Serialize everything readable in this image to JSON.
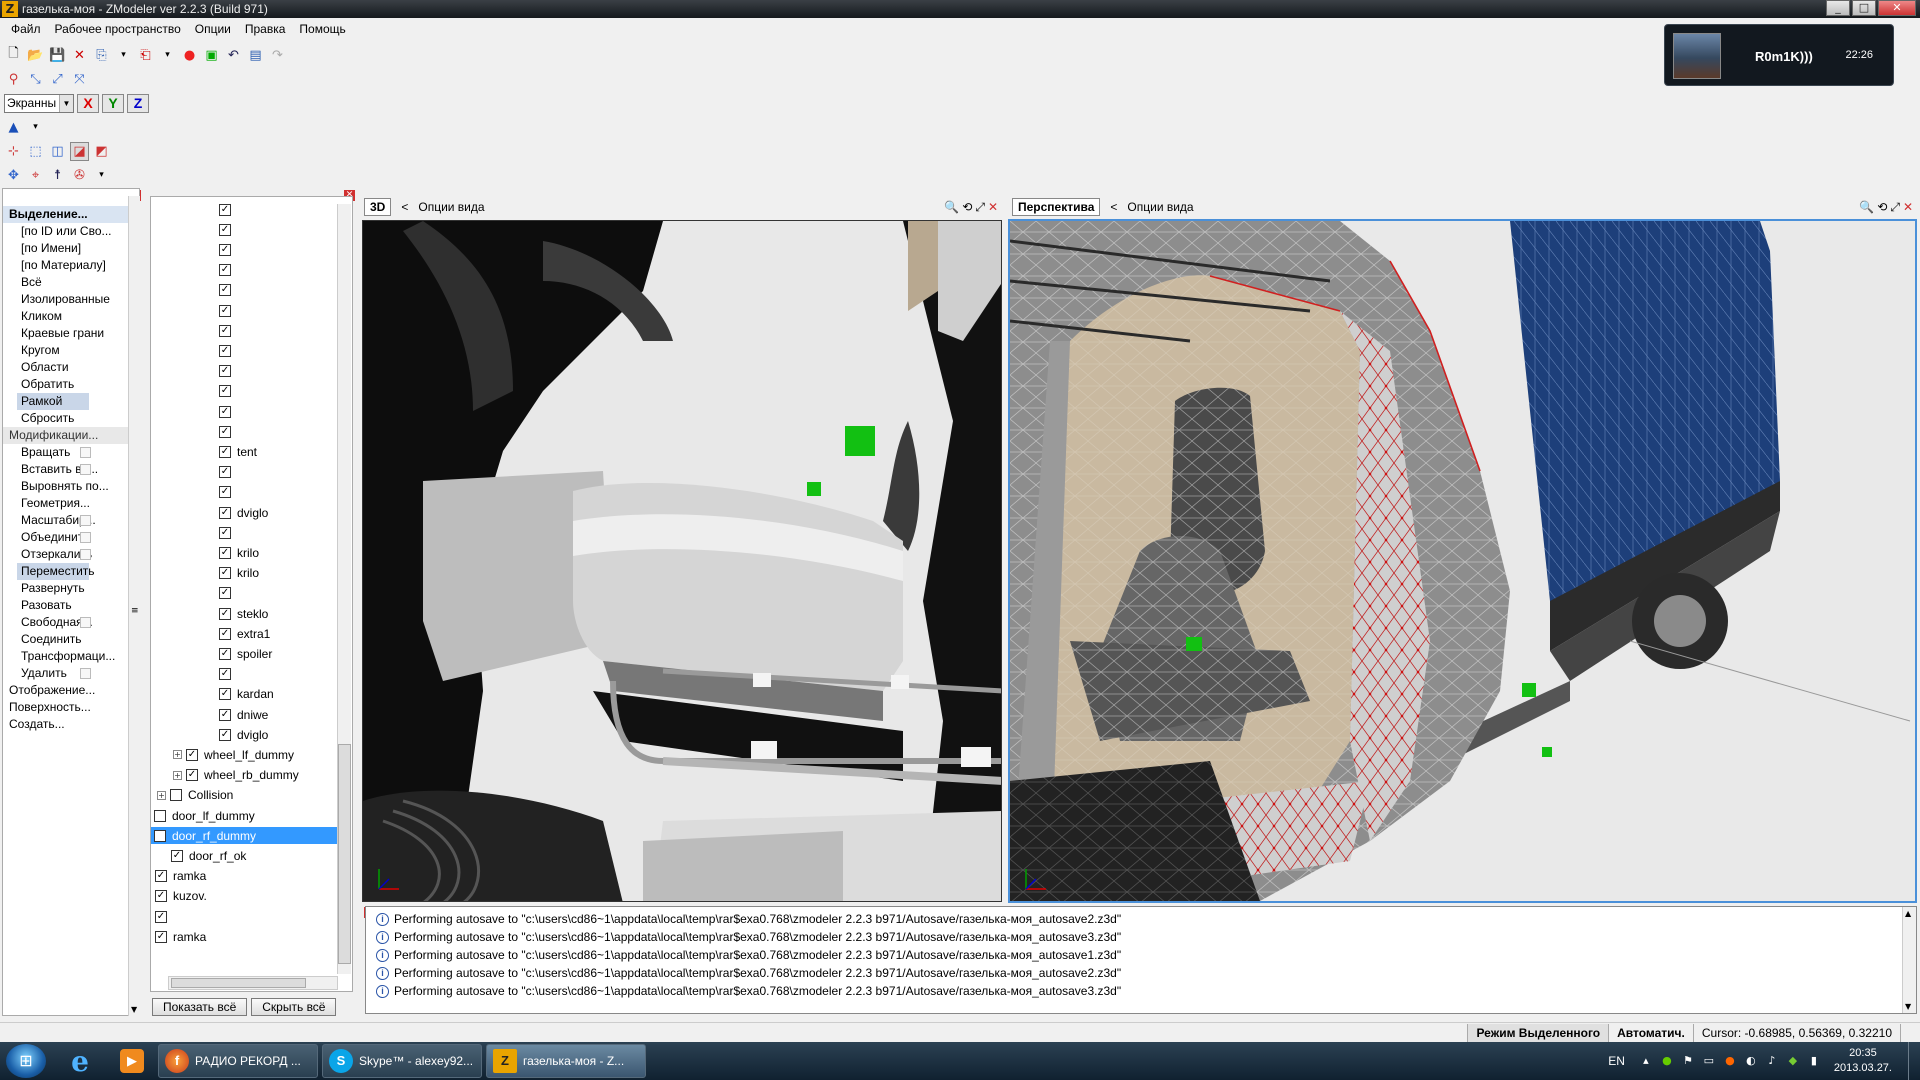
{
  "window": {
    "title": "газелька-моя - ZModeler ver 2.2.3 (Build 971)",
    "icon_letter": "Z"
  },
  "menu": [
    "Файл",
    "Рабочее пространство",
    "Опции",
    "Правка",
    "Помощь"
  ],
  "coord_combo": "Экранны",
  "axes": [
    "X",
    "Y",
    "Z"
  ],
  "skype_popup": {
    "name": "R0m1K)))",
    "time": "22:26"
  },
  "left_panel": {
    "selection_header": "Выделение...",
    "selection_items": [
      "[по ID или Сво...",
      "[по Имени]",
      "[по Материалу]",
      "Всё",
      "Изолированные",
      "Кликом",
      "Краевые грани",
      "Кругом",
      "Области",
      "Обратить",
      "Рамкой",
      "Сбросить"
    ],
    "modification_header": "Модификации...",
    "modification_items": [
      "Вращать",
      "Вставить ве...",
      "Выровнять по...",
      "Геометрия...",
      "Масштабир...",
      "Объединить",
      "Отзеркалить",
      "Переместить",
      "Развернуть",
      "Разовать",
      "Свободная...",
      "Соединить",
      "Трансформаци...",
      "Удалить"
    ],
    "bottom_items": [
      "Отображение...",
      "Поверхность...",
      "Создать..."
    ]
  },
  "tree": {
    "nested_labels": [
      "",
      "",
      "",
      "",
      "",
      "",
      "",
      "",
      "",
      "",
      "",
      "",
      "tent",
      "",
      "",
      "dviglo",
      "",
      "krilo",
      "krilo",
      "",
      "steklo",
      "extra1",
      "spoiler",
      "",
      "kardan",
      "dniwe",
      "dviglo"
    ],
    "groups": [
      "wheel_lf_dummy",
      "wheel_rb_dummy"
    ],
    "collision": "Collision",
    "root_items": [
      {
        "label": "door_lf_dummy",
        "checked": false
      },
      {
        "label": "door_rf_dummy",
        "checked": false,
        "selected": true
      },
      {
        "label": "door_rf_ok",
        "checked": true,
        "child": true
      },
      {
        "label": "ramka",
        "checked": true
      },
      {
        "label": "kuzov.",
        "checked": true
      },
      {
        "label": "",
        "checked": true
      },
      {
        "label": "ramka",
        "checked": true
      }
    ],
    "show_all": "Показать всё",
    "hide_all": "Скрыть всё"
  },
  "viewports": {
    "left": {
      "label": "3D",
      "options": "Опции вида"
    },
    "right": {
      "label": "Перспектива",
      "options": "Опции вида"
    }
  },
  "log": [
    "Performing autosave to \"c:\\users\\cd86~1\\appdata\\local\\temp\\rar$exa0.768\\zmodeler 2.2.3 b971/Autosave/газелька-моя_autosave2.z3d\"",
    "Performing autosave to \"c:\\users\\cd86~1\\appdata\\local\\temp\\rar$exa0.768\\zmodeler 2.2.3 b971/Autosave/газелька-моя_autosave3.z3d\"",
    "Performing autosave to \"c:\\users\\cd86~1\\appdata\\local\\temp\\rar$exa0.768\\zmodeler 2.2.3 b971/Autosave/газелька-моя_autosave1.z3d\"",
    "Performing autosave to \"c:\\users\\cd86~1\\appdata\\local\\temp\\rar$exa0.768\\zmodeler 2.2.3 b971/Autosave/газелька-моя_autosave2.z3d\"",
    "Performing autosave to \"c:\\users\\cd86~1\\appdata\\local\\temp\\rar$exa0.768\\zmodeler 2.2.3 b971/Autosave/газелька-моя_autosave3.z3d\""
  ],
  "status": {
    "mode": "Режим Выделенного",
    "auto": "Автоматич.",
    "cursor": "Cursor: -0.68985, 0.56369, 0.32210"
  },
  "taskbar": {
    "apps": [
      {
        "label": "РАДИО РЕКОРД ...",
        "icon": "firefox-icon"
      },
      {
        "label": "Skype™ - alexey92...",
        "icon": "skype-icon"
      },
      {
        "label": "газелька-моя - Z...",
        "icon": "zmodeler-icon"
      }
    ],
    "lang": "EN",
    "time": "20:35",
    "date": "2013.03.27."
  },
  "colors": {
    "selection": "#3399ff",
    "accent_red": "#d03030",
    "viewport_bg": "#e9e9e9"
  }
}
